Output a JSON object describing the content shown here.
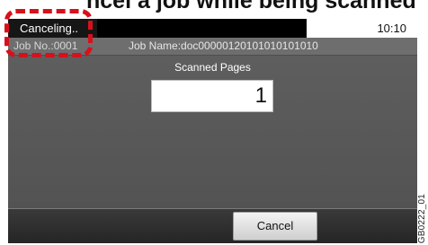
{
  "cropped_heading": "ncel a job while being scanned",
  "status_bar": {
    "message": "Canceling..",
    "time": "10:10"
  },
  "info_bar": {
    "job_no": "Job No.:0001",
    "job_name": "Job Name:doc00000120101010101010"
  },
  "main": {
    "scanned_pages_label": "Scanned Pages",
    "scanned_pages_value": "1"
  },
  "bottom_bar": {
    "cancel_label": "Cancel"
  },
  "figure_id": "GB0222_01",
  "colors": {
    "callout": "#d8101c",
    "panel_background": "#5a5a5a",
    "status_background": "#161616"
  }
}
